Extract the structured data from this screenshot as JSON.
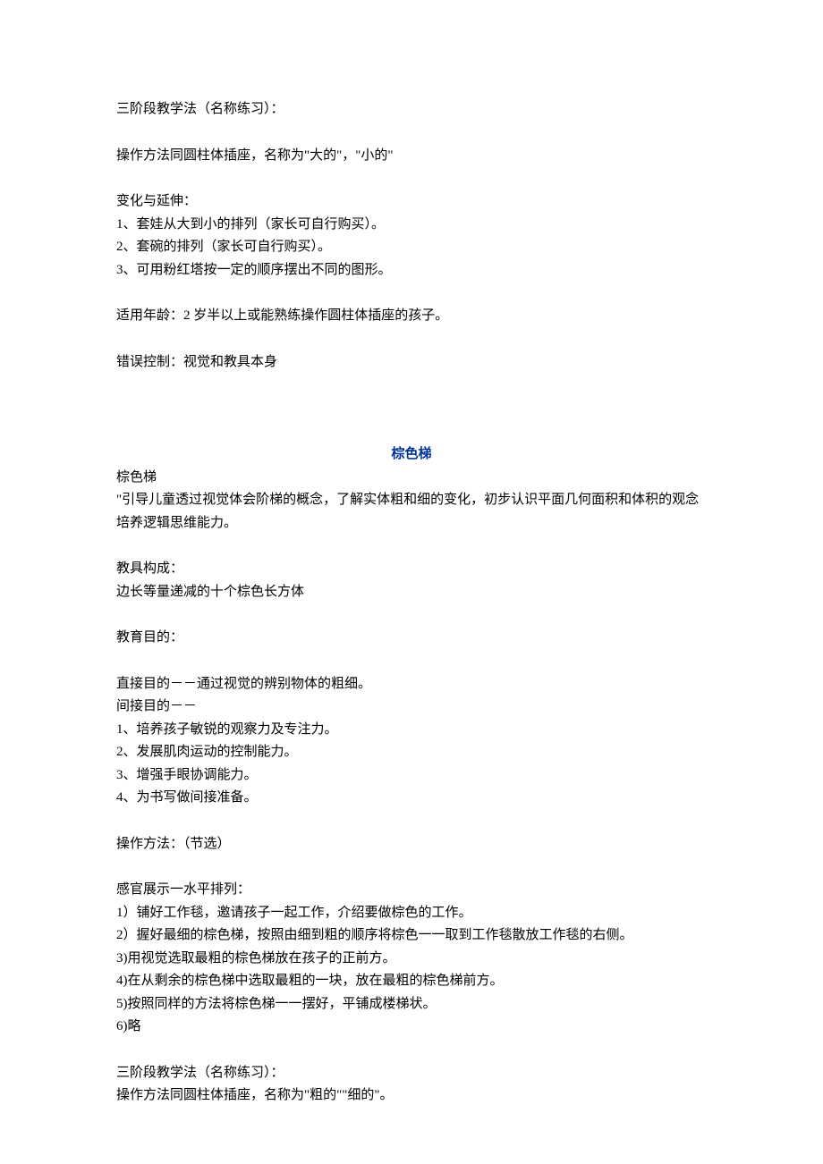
{
  "section1": {
    "heading1": "三阶段教学法（名称练习）：",
    "p1": "操作方法同圆柱体插座，名称为\"大的\"，\"小的\"",
    "heading2": "变化与延伸：",
    "v1": "1、套娃从大到小的排列（家长可自行购买）。",
    "v2": "2、套碗的排列（家长可自行购买）。",
    "v3": "3、可用粉红塔按一定的顺序摆出不同的图形。",
    "age": "适用年龄：2 岁半以上或能熟练操作圆柱体插座的孩子。",
    "error": "错误控制：视觉和教具本身"
  },
  "section2": {
    "title": "棕色梯",
    "name": "棕色梯",
    "intro": "\"引导儿童透过视觉体会阶梯的概念，了解实体粗和细的变化，初步认识平面几何面积和体积的观念培养逻辑思维能力。",
    "compHeading": "教具构成：",
    "compBody": "边长等量递减的十个棕色长方体",
    "eduHeading": "教育目的：",
    "direct": "直接目的－－通过视觉的辨别物体的粗细。",
    "indirectHeading": "间接目的－－",
    "i1": "1、培养孩子敏锐的观察力及专注力。",
    "i2": "2、发展肌肉运动的控制能力。",
    "i3": "3、增强手眼协调能力。",
    "i4": "4、为书写做间接准备。",
    "opHeading": "操作方法：（节选）",
    "senseHeading": "感官展示一水平排列：",
    "s1": "1）铺好工作毯，邀请孩子一起工作，介绍要做棕色的工作。",
    "s2": "2）握好最细的棕色梯，按照由细到粗的顺序将棕色一一取到工作毯散放工作毯的右侧。",
    "s3": "3)用视觉选取最粗的棕色梯放在孩子的正前方。",
    "s4": "4)在从剩余的棕色梯中选取最粗的一块，放在最粗的棕色梯前方。",
    "s5": "5)按照同样的方法将棕色梯一一摆好，平铺成楼梯状。",
    "s6": "6)略",
    "threeStageHeading": "三阶段教学法（名称练习）：",
    "threeStageBody": "操作方法同圆柱体插座，名称为\"粗的\"\"细的\"。"
  }
}
